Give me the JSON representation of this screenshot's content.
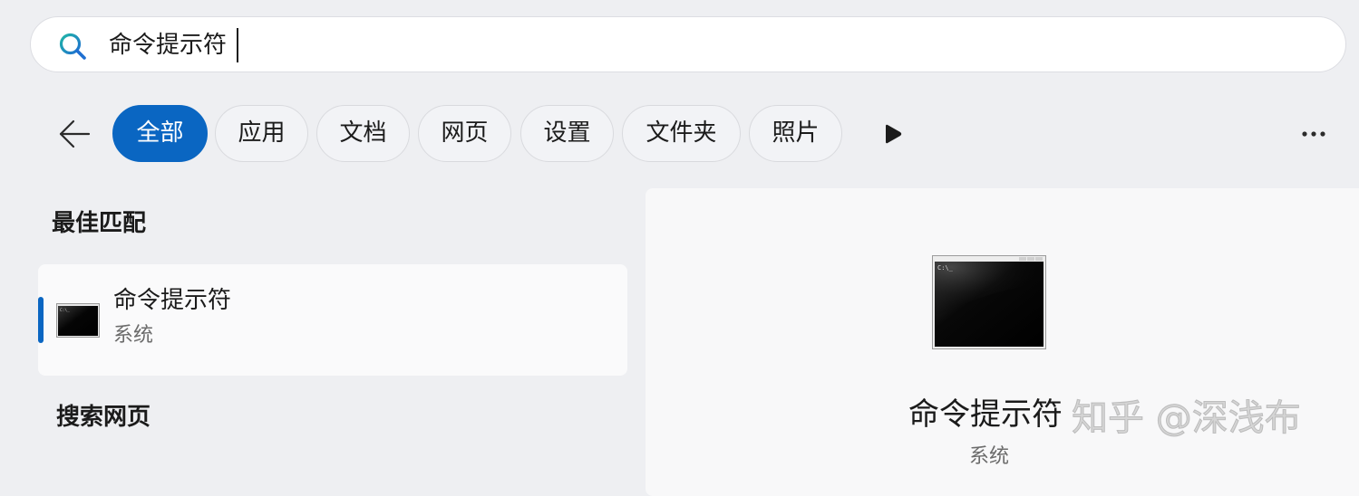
{
  "search": {
    "query": "命令提示符"
  },
  "filters": [
    {
      "label": "全部",
      "active": true
    },
    {
      "label": "应用",
      "active": false
    },
    {
      "label": "文档",
      "active": false
    },
    {
      "label": "网页",
      "active": false
    },
    {
      "label": "设置",
      "active": false
    },
    {
      "label": "文件夹",
      "active": false
    },
    {
      "label": "照片",
      "active": false
    }
  ],
  "sections": {
    "best_match": "最佳匹配",
    "search_web": "搜索网页"
  },
  "best_match_item": {
    "title": "命令提示符",
    "subtitle": "系统",
    "icon": "command-prompt-icon",
    "icon_text": "C:\\_"
  },
  "detail": {
    "title": "命令提示符",
    "subtitle": "系统",
    "icon": "command-prompt-icon",
    "icon_text": "C:\\_"
  },
  "watermark": "知乎 @深浅布",
  "colors": {
    "accent": "#0a66c2",
    "background": "#eeeff2",
    "search_icon_teal": "#1fb5a6",
    "search_icon_blue": "#1f6fd1"
  }
}
